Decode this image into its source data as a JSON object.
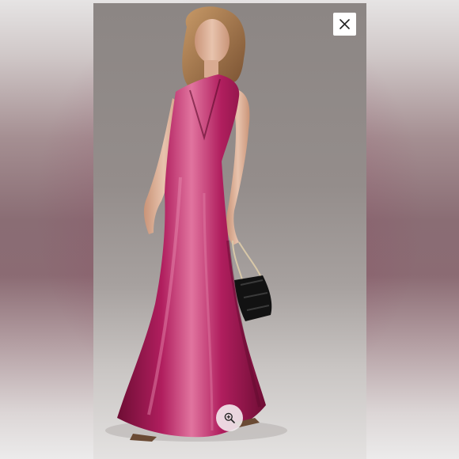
{
  "viewer": {
    "close_icon": "close-icon",
    "zoom_icon": "zoom-in-icon"
  },
  "photo": {
    "subject": "woman-in-satin-halter-gown",
    "colors": {
      "gown": "#b01e5e",
      "gown_shadow": "#6e0d34",
      "gown_highlight": "#e1749f",
      "background": "#8f8886",
      "hair": "#a97a4c",
      "skin": "#e3b9a0",
      "bag": "#121212"
    }
  }
}
